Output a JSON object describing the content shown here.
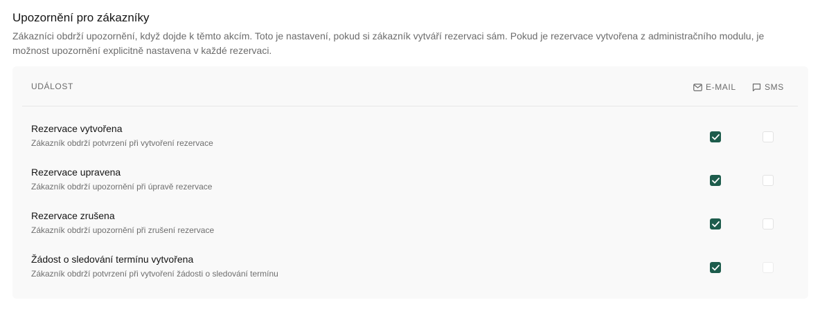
{
  "section": {
    "title": "Upozornění pro zákazníky",
    "description": "Zákazníci obdrží upozornění, když dojde k těmto akcím. Toto je nastavení, pokud si zákazník vytváří rezervaci sám. Pokud je rezervace vytvořena z administračního modulu, je možnost upozornění explicitně nastavena v každé rezervaci."
  },
  "table": {
    "col_event": "UDÁLOST",
    "col_email": "E-MAIL",
    "col_sms": "SMS",
    "email_icon": "mail-icon",
    "sms_icon": "chat-bubble-icon",
    "rows": [
      {
        "title": "Rezervace vytvořena",
        "subtitle": "Zákazník obdrží potvrzení při vytvoření rezervace",
        "email": true,
        "sms": false
      },
      {
        "title": "Rezervace upravena",
        "subtitle": "Zákazník obdrží upozornění při úpravě rezervace",
        "email": true,
        "sms": false
      },
      {
        "title": "Rezervace zrušena",
        "subtitle": "Zákazník obdrží upozornění při zrušení rezervace",
        "email": true,
        "sms": false
      },
      {
        "title": "Žádost o sledování termínu vytvořena",
        "subtitle": "Zákazník obdrží potvrzení při vytvoření žádosti o sledování termínu",
        "email": true,
        "sms": false
      }
    ]
  },
  "colors": {
    "accent": "#1d5c4c",
    "muted_text": "#6b6b6b",
    "panel_bg": "#f9f9f9"
  }
}
